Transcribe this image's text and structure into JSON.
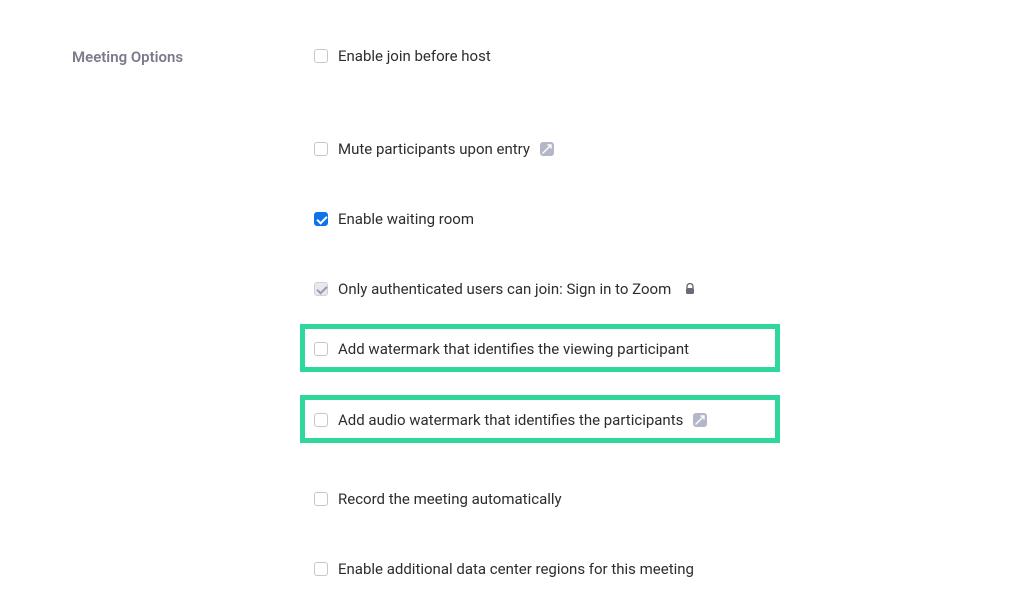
{
  "section": {
    "title": "Meeting Options"
  },
  "options": {
    "join_before_host": {
      "label": "Enable join before host"
    },
    "mute_on_entry": {
      "label": "Mute participants upon entry"
    },
    "waiting_room": {
      "label": "Enable waiting room"
    },
    "authenticated_only": {
      "label": "Only authenticated users can join: Sign in to Zoom"
    },
    "watermark": {
      "label": "Add watermark that identifies the viewing participant"
    },
    "audio_watermark": {
      "label": "Add audio watermark that identifies the participants"
    },
    "record_auto": {
      "label": "Record the meeting automatically"
    },
    "data_center_regions": {
      "label": "Enable additional data center regions for this meeting"
    }
  }
}
